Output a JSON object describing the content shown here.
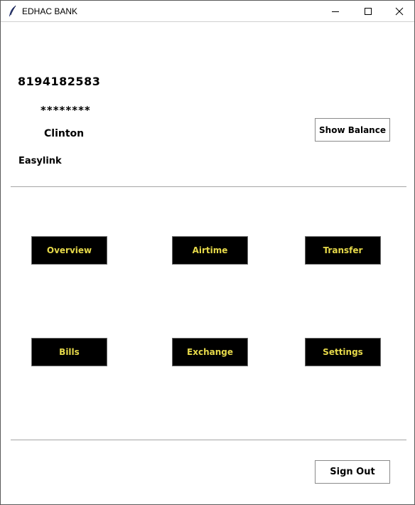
{
  "window": {
    "title": "EDHAC BANK",
    "icon": "feather-icon",
    "controls": [
      "minimize-icon",
      "maximize-icon",
      "close-icon"
    ]
  },
  "account": {
    "number": "8194182583",
    "balance_masked": "********",
    "holder_name": "Clinton",
    "bank_name": "Easylink"
  },
  "actions": {
    "show_balance": "Show Balance",
    "sign_out": "Sign Out"
  },
  "menu": {
    "overview": "Overview",
    "airtime": "Airtime",
    "transfer": "Transfer",
    "bills": "Bills",
    "exchange": "Exchange",
    "settings": "Settings"
  },
  "colors": {
    "menu_button_bg": "#000000",
    "menu_button_text": "#e6d94a"
  }
}
